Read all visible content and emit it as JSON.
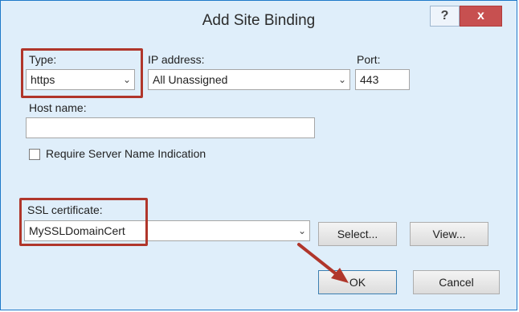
{
  "window": {
    "title": "Add Site Binding",
    "help_label": "?",
    "close_label": "x"
  },
  "form": {
    "type_label": "Type:",
    "type_value": "https",
    "ip_label": "IP address:",
    "ip_value": "All Unassigned",
    "port_label": "Port:",
    "port_value": "443",
    "host_label": "Host name:",
    "host_value": "",
    "sni_label": "Require Server Name Indication",
    "sni_checked": false,
    "ssl_label": "SSL certificate:",
    "ssl_value": "MySSLDomainCert"
  },
  "buttons": {
    "select": "Select...",
    "view": "View...",
    "ok": "OK",
    "cancel": "Cancel"
  },
  "dropdown_glyph": "⌄",
  "annotation_color": "#b0362b"
}
